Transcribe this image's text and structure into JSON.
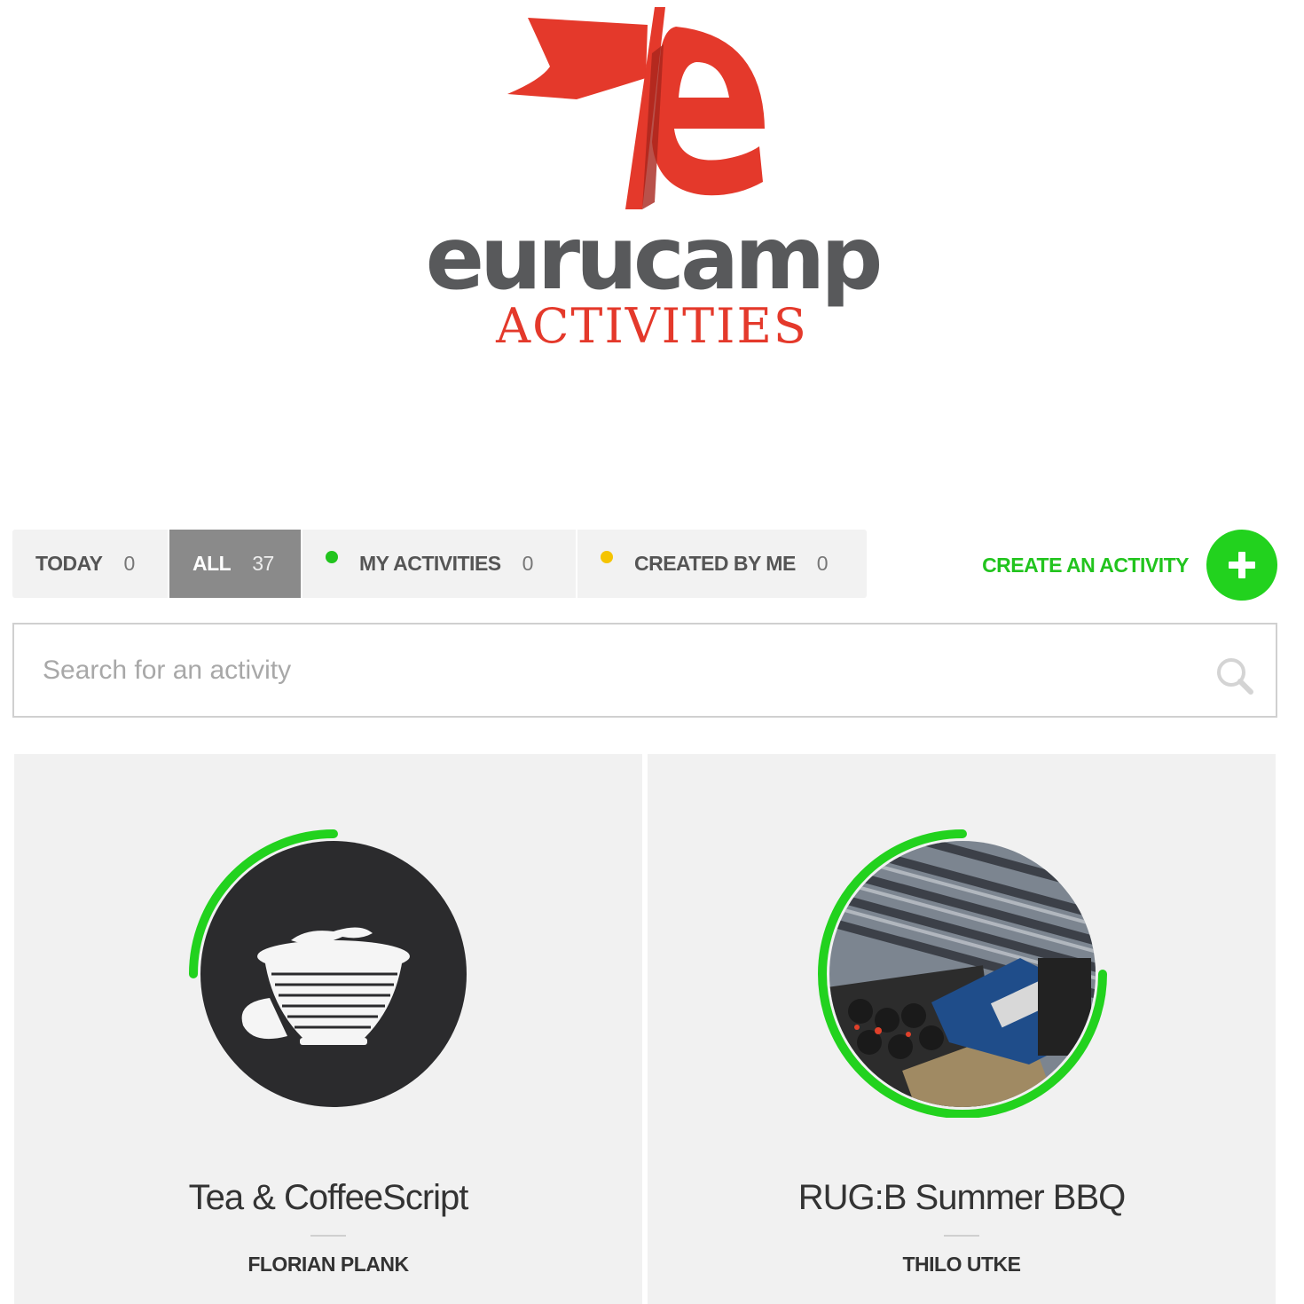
{
  "brand": {
    "name": "eurucamp",
    "subtitle": "ACTIVITIES",
    "primary_color": "#e4392b",
    "text_color": "#58595b"
  },
  "filters": [
    {
      "label": "TODAY",
      "count": "0",
      "dot": null,
      "active": false
    },
    {
      "label": "ALL",
      "count": "37",
      "dot": null,
      "active": true
    },
    {
      "label": "MY ACTIVITIES",
      "count": "0",
      "dot": "#22c41e",
      "active": false
    },
    {
      "label": "CREATED BY ME",
      "count": "0",
      "dot": "#f5c400",
      "active": false
    }
  ],
  "create": {
    "label": "CREATE AN ACTIVITY",
    "icon": "plus-icon",
    "color": "#22d21e"
  },
  "search": {
    "placeholder": "Search for an activity",
    "value": "",
    "icon": "search-icon"
  },
  "activities": [
    {
      "title": "Tea & CoffeeScript",
      "author": "FLORIAN PLANK",
      "image": "coffee-cup-icon",
      "progress": 0.25,
      "progress_color": "#22d21e"
    },
    {
      "title": "RUG:B Summer BBQ",
      "author": "THILO UTKE",
      "image": "bbq-photo",
      "progress": 0.75,
      "progress_color": "#22d21e"
    }
  ]
}
